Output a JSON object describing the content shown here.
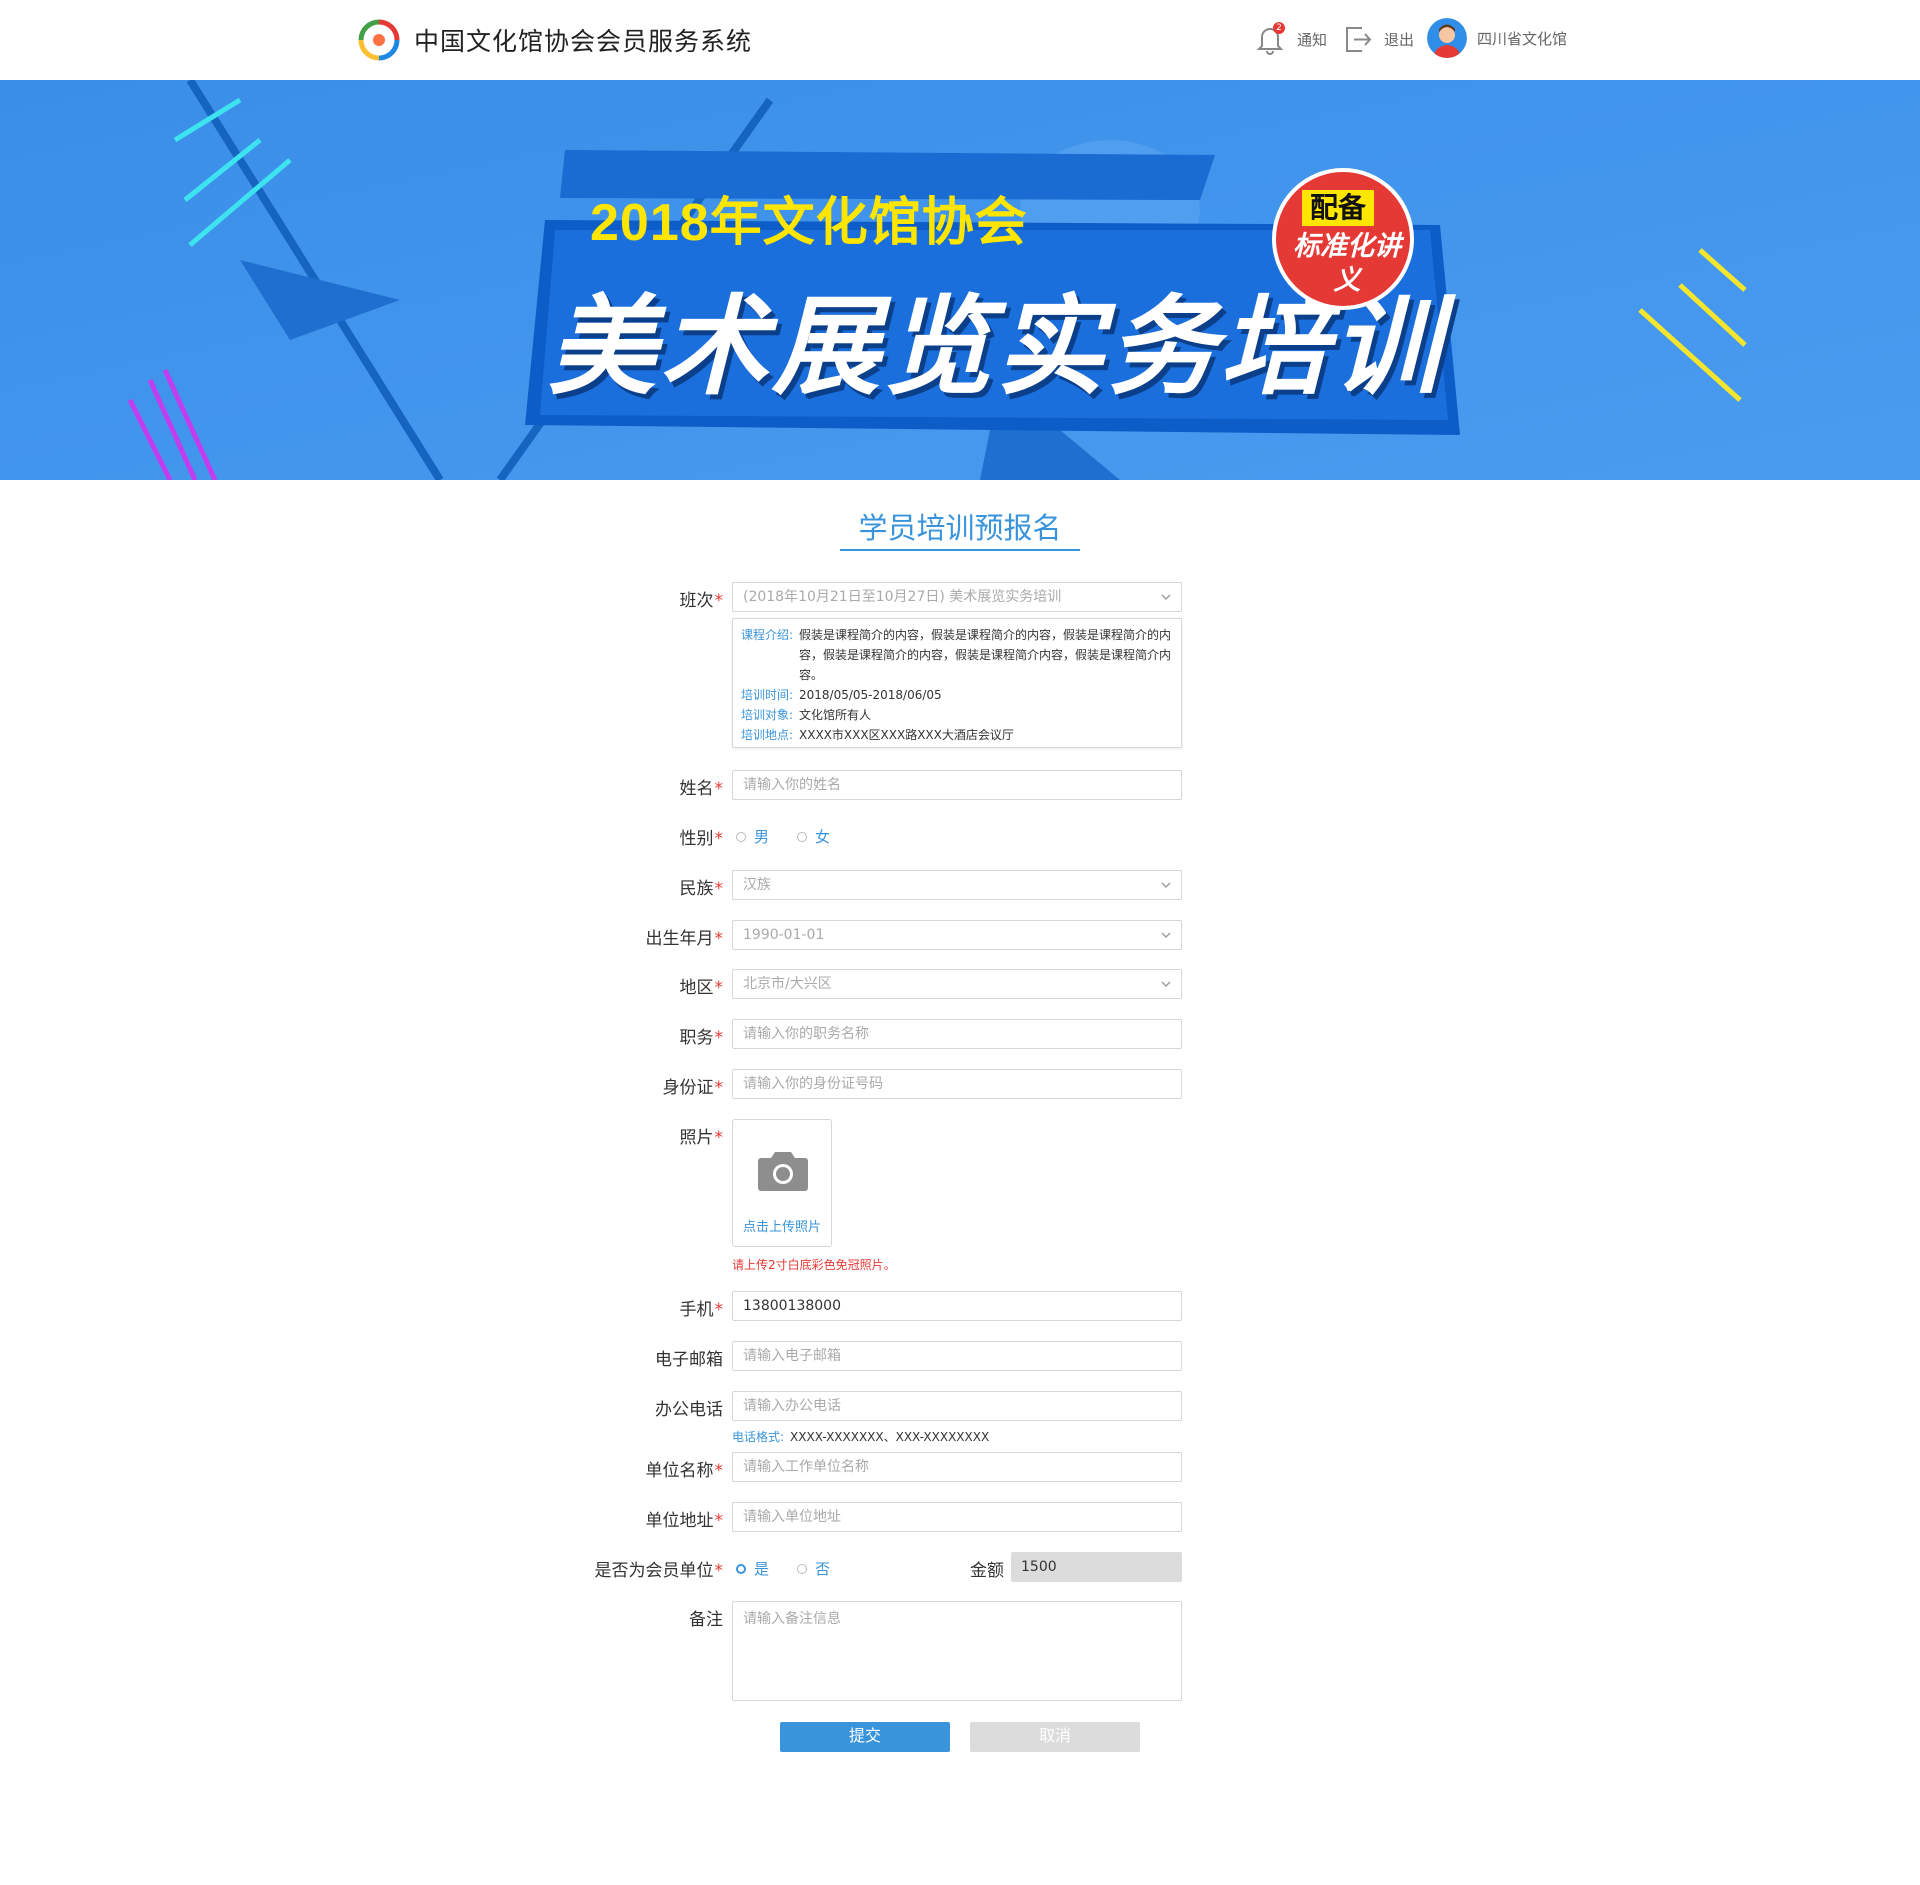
{
  "header": {
    "app_title": "中国文化馆协会会员服务系统",
    "notify_label": "通知",
    "notify_count": "2",
    "logout_label": "退出",
    "user_name": "四川省文化馆"
  },
  "banner": {
    "year_title": "2018年文化馆协会",
    "main_title": "美术展览实务培训",
    "bubble_top": "配备",
    "bubble_bottom": "标准化讲义"
  },
  "form": {
    "title": "学员培训预报名",
    "class": {
      "label": "班次",
      "value": "(2018年10月21日至10月27日) 美术展览实务培训",
      "course_intro_key": "课程介绍:",
      "course_intro_val": "假装是课程简介的内容，假装是课程简介的内容，假装是课程简介的内容，假装是课程简介的内容，假装是课程简介内容，假装是课程简介内容。",
      "time_key": "培训时间:",
      "time_val": "2018/05/05-2018/06/05",
      "target_key": "培训对象:",
      "target_val": "文化馆所有人",
      "place_key": "培训地点:",
      "place_val": "XXXX市XXX区XXX路XXX大酒店会议厅"
    },
    "name": {
      "label": "姓名",
      "placeholder": "请输入你的姓名"
    },
    "gender": {
      "label": "性别",
      "male": "男",
      "female": "女"
    },
    "ethnicity": {
      "label": "民族",
      "value": "汉族"
    },
    "birth": {
      "label": "出生年月",
      "value": "1990-01-01"
    },
    "region": {
      "label": "地区",
      "value": "北京市/大兴区"
    },
    "position": {
      "label": "职务",
      "placeholder": "请输入你的职务名称"
    },
    "id_card": {
      "label": "身份证",
      "placeholder": "请输入你的身份证号码"
    },
    "photo": {
      "label": "照片",
      "upload_text": "点击上传照片",
      "hint": "请上传2寸白底彩色免冠照片。"
    },
    "mobile": {
      "label": "手机",
      "value": "13800138000"
    },
    "email": {
      "label": "电子邮箱",
      "placeholder": "请输入电子邮箱"
    },
    "office_phone": {
      "label": "办公电话",
      "placeholder": "请输入办公电话",
      "hint_key": "电话格式:",
      "hint_val": "XXXX-XXXXXXX、XXX-XXXXXXXX"
    },
    "company_name": {
      "label": "单位名称",
      "placeholder": "请输入工作单位名称"
    },
    "company_addr": {
      "label": "单位地址",
      "placeholder": "请输入单位地址"
    },
    "member_unit": {
      "label": "是否为会员单位",
      "yes": "是",
      "no": "否"
    },
    "amount": {
      "label": "金额",
      "value": "1500"
    },
    "remark": {
      "label": "备注",
      "placeholder": "请输入备注信息"
    },
    "submit_label": "提交",
    "cancel_label": "取消"
  },
  "colors": {
    "accent": "#3a94dc",
    "required": "#e53935",
    "banner_bg": "#2b8ae6",
    "banner_yellow": "#ffe600"
  }
}
